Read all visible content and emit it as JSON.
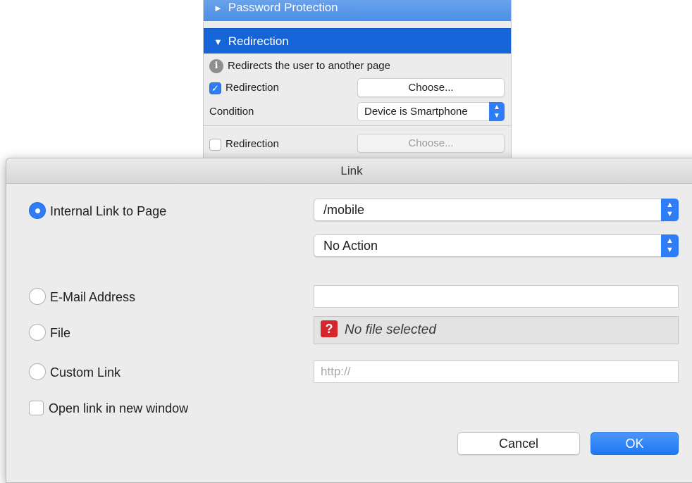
{
  "panel": {
    "password_section": "Password Protection",
    "redirection_section": "Redirection",
    "info_text": "Redirects the user to another page",
    "rule1": {
      "label": "Redirection",
      "checked": true,
      "button": "Choose..."
    },
    "condition": {
      "label": "Condition",
      "value": "Device is Smartphone"
    },
    "rule2": {
      "label": "Redirection",
      "checked": false,
      "button": "Choose..."
    }
  },
  "dialog": {
    "title": "Link",
    "internal": {
      "label": "Internal Link to Page",
      "selected": true,
      "page": "/mobile",
      "action": "No Action"
    },
    "email": {
      "label": "E-Mail Address",
      "value": ""
    },
    "file": {
      "label": "File",
      "status": "No file selected"
    },
    "custom": {
      "label": "Custom Link",
      "placeholder": "http://"
    },
    "new_window": {
      "label": "Open link in new window",
      "checked": false
    },
    "cancel": "Cancel",
    "ok": "OK"
  },
  "colors": {
    "accent": "#2e7cf6",
    "section_header": "#1565d8",
    "file_warning": "#d6262b"
  }
}
